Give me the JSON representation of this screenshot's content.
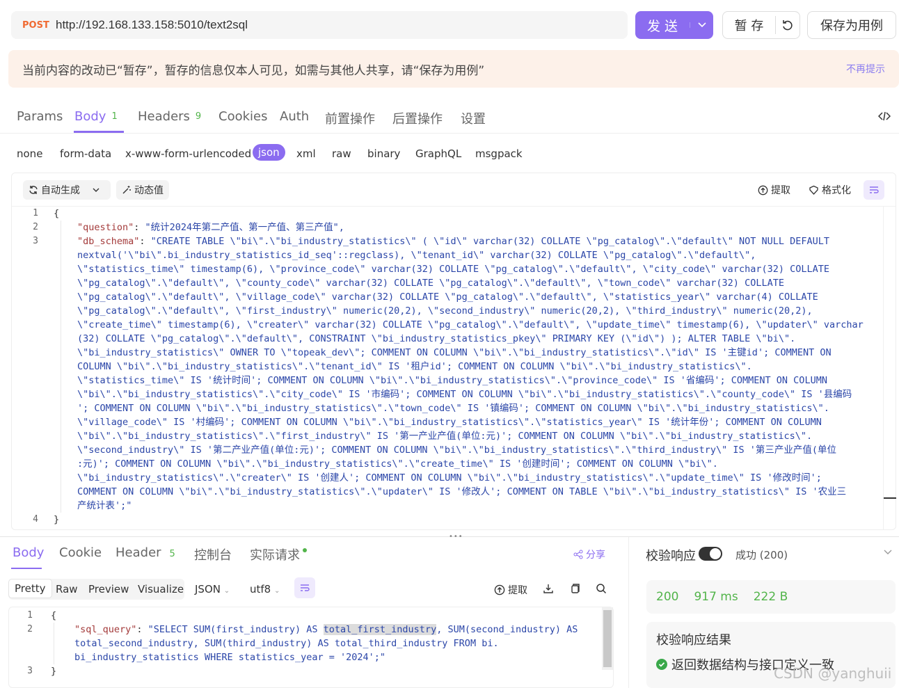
{
  "request": {
    "method": "POST",
    "url": "http://192.168.133.158:5010/text2sql",
    "send_label": "发 送",
    "save_label": "暂 存",
    "save_as_label": "保存为用例"
  },
  "notice": {
    "text": "当前内容的改动已“暂存”，暂存的信息仅本人可见，如需与其他人共享，请“保存为用例”",
    "dismiss": "不再提示"
  },
  "tabs": [
    {
      "label": "Params"
    },
    {
      "label": "Body",
      "count": "1"
    },
    {
      "label": "Headers",
      "count": "9"
    },
    {
      "label": "Cookies"
    },
    {
      "label": "Auth"
    },
    {
      "label": "前置操作"
    },
    {
      "label": "后置操作"
    },
    {
      "label": "设置"
    }
  ],
  "body_types": [
    "none",
    "form-data",
    "x-www-form-urlencoded",
    "json",
    "xml",
    "raw",
    "binary",
    "GraphQL",
    "msgpack"
  ],
  "editor_toolbar": {
    "auto_generate": "自动生成",
    "dynamic_value": "动态值",
    "extract": "提取",
    "format": "格式化"
  },
  "request_body": {
    "line_numbers": [
      "1",
      "2",
      "3",
      "4"
    ],
    "open_brace": "{",
    "close_brace": "}",
    "question_key": "\"question\"",
    "question_value": "\"统计2024年第二产值、第一产值、第三产值\",",
    "schema_key": "\"db_schema\"",
    "schema_lines": [
      "\"CREATE TABLE \\\"bi\\\".\\\"bi_industry_statistics\\\" ( \\\"id\\\" varchar(32) COLLATE \\\"pg_catalog\\\".\\\"default\\\" NOT NULL DEFAULT",
      "nextval('\\\"bi\\\".bi_industry_statistics_id_seq'::regclass), \\\"tenant_id\\\" varchar(32) COLLATE \\\"pg_catalog\\\".\\\"default\\\",",
      "\\\"statistics_time\\\" timestamp(6), \\\"province_code\\\" varchar(32) COLLATE \\\"pg_catalog\\\".\\\"default\\\", \\\"city_code\\\" varchar(32) COLLATE",
      "\\\"pg_catalog\\\".\\\"default\\\", \\\"county_code\\\" varchar(32) COLLATE \\\"pg_catalog\\\".\\\"default\\\", \\\"town_code\\\" varchar(32) COLLATE",
      "\\\"pg_catalog\\\".\\\"default\\\", \\\"village_code\\\" varchar(32) COLLATE \\\"pg_catalog\\\".\\\"default\\\", \\\"statistics_year\\\" varchar(4) COLLATE",
      "\\\"pg_catalog\\\".\\\"default\\\", \\\"first_industry\\\" numeric(20,2), \\\"second_industry\\\" numeric(20,2), \\\"third_industry\\\" numeric(20,2),",
      "\\\"create_time\\\" timestamp(6), \\\"creater\\\" varchar(32) COLLATE \\\"pg_catalog\\\".\\\"default\\\", \\\"update_time\\\" timestamp(6), \\\"updater\\\" varchar",
      "(32) COLLATE \\\"pg_catalog\\\".\\\"default\\\", CONSTRAINT \\\"bi_industry_statistics_pkey\\\" PRIMARY KEY (\\\"id\\\") ); ALTER TABLE \\\"bi\\\".",
      "\\\"bi_industry_statistics\\\" OWNER TO \\\"topeak_dev\\\"; COMMENT ON COLUMN \\\"bi\\\".\\\"bi_industry_statistics\\\".\\\"id\\\" IS '主键id'; COMMENT ON",
      "COLUMN \\\"bi\\\".\\\"bi_industry_statistics\\\".\\\"tenant_id\\\" IS '租户id'; COMMENT ON COLUMN \\\"bi\\\".\\\"bi_industry_statistics\\\".",
      "\\\"statistics_time\\\" IS '统计时间'; COMMENT ON COLUMN \\\"bi\\\".\\\"bi_industry_statistics\\\".\\\"province_code\\\" IS '省编码'; COMMENT ON COLUMN",
      "\\\"bi\\\".\\\"bi_industry_statistics\\\".\\\"city_code\\\" IS '市编码'; COMMENT ON COLUMN \\\"bi\\\".\\\"bi_industry_statistics\\\".\\\"county_code\\\" IS '县编码",
      "'; COMMENT ON COLUMN \\\"bi\\\".\\\"bi_industry_statistics\\\".\\\"town_code\\\" IS '镇编码'; COMMENT ON COLUMN \\\"bi\\\".\\\"bi_industry_statistics\\\".",
      "\\\"village_code\\\" IS '村编码'; COMMENT ON COLUMN \\\"bi\\\".\\\"bi_industry_statistics\\\".\\\"statistics_year\\\" IS '统计年份'; COMMENT ON COLUMN",
      "\\\"bi\\\".\\\"bi_industry_statistics\\\".\\\"first_industry\\\" IS '第一产业产值(单位:元)'; COMMENT ON COLUMN \\\"bi\\\".\\\"bi_industry_statistics\\\".",
      "\\\"second_industry\\\" IS '第二产业产值(单位:元)'; COMMENT ON COLUMN \\\"bi\\\".\\\"bi_industry_statistics\\\".\\\"third_industry\\\" IS '第三产业产值(单位",
      ":元)'; COMMENT ON COLUMN \\\"bi\\\".\\\"bi_industry_statistics\\\".\\\"create_time\\\" IS '创建时间'; COMMENT ON COLUMN \\\"bi\\\".",
      "\\\"bi_industry_statistics\\\".\\\"creater\\\" IS '创建人'; COMMENT ON COLUMN \\\"bi\\\".\\\"bi_industry_statistics\\\".\\\"update_time\\\" IS '修改时间';",
      "COMMENT ON COLUMN \\\"bi\\\".\\\"bi_industry_statistics\\\".\\\"updater\\\" IS '修改人'; COMMENT ON TABLE \\\"bi\\\".\\\"bi_industry_statistics\\\" IS '农业三",
      "产统计表';\""
    ]
  },
  "response_tabs": [
    {
      "label": "Body"
    },
    {
      "label": "Cookie"
    },
    {
      "label": "Header",
      "count": "5"
    },
    {
      "label": "控制台"
    },
    {
      "label": "实际请求"
    }
  ],
  "share_label": "分享",
  "view_modes": [
    "Pretty",
    "Raw",
    "Preview",
    "Visualize"
  ],
  "format": {
    "type": "JSON",
    "encoding": "utf8"
  },
  "response_toolbar": {
    "extract": "提取"
  },
  "response_body": {
    "line_numbers": [
      "1",
      "2",
      "3"
    ],
    "open_brace": "{",
    "close_brace": "}",
    "key": "\"sql_query\"",
    "line1_a": "\"SELECT SUM(first_industry) AS ",
    "line1_hl": "total_first_industry",
    "line1_b": ", SUM(second_industry) AS",
    "line2": "total_second_industry, SUM(third_industry) AS total_third_industry FROM bi.",
    "line3": "bi_industry_statistics WHERE statistics_year = '2024';\""
  },
  "validation": {
    "title": "校验响应",
    "status": "成功 (200)",
    "code": "200",
    "time": "917 ms",
    "size": "222 B",
    "result_title": "校验响应结果",
    "result_text": "返回数据结构与接口定义一致"
  },
  "watermark": "CSDN @yanghuii",
  "colors": {
    "accent": "#8b6cf0",
    "method": "#f06a32",
    "success": "#52b44a",
    "json_key": "#a33a3a",
    "json_string": "#2b46a8"
  }
}
